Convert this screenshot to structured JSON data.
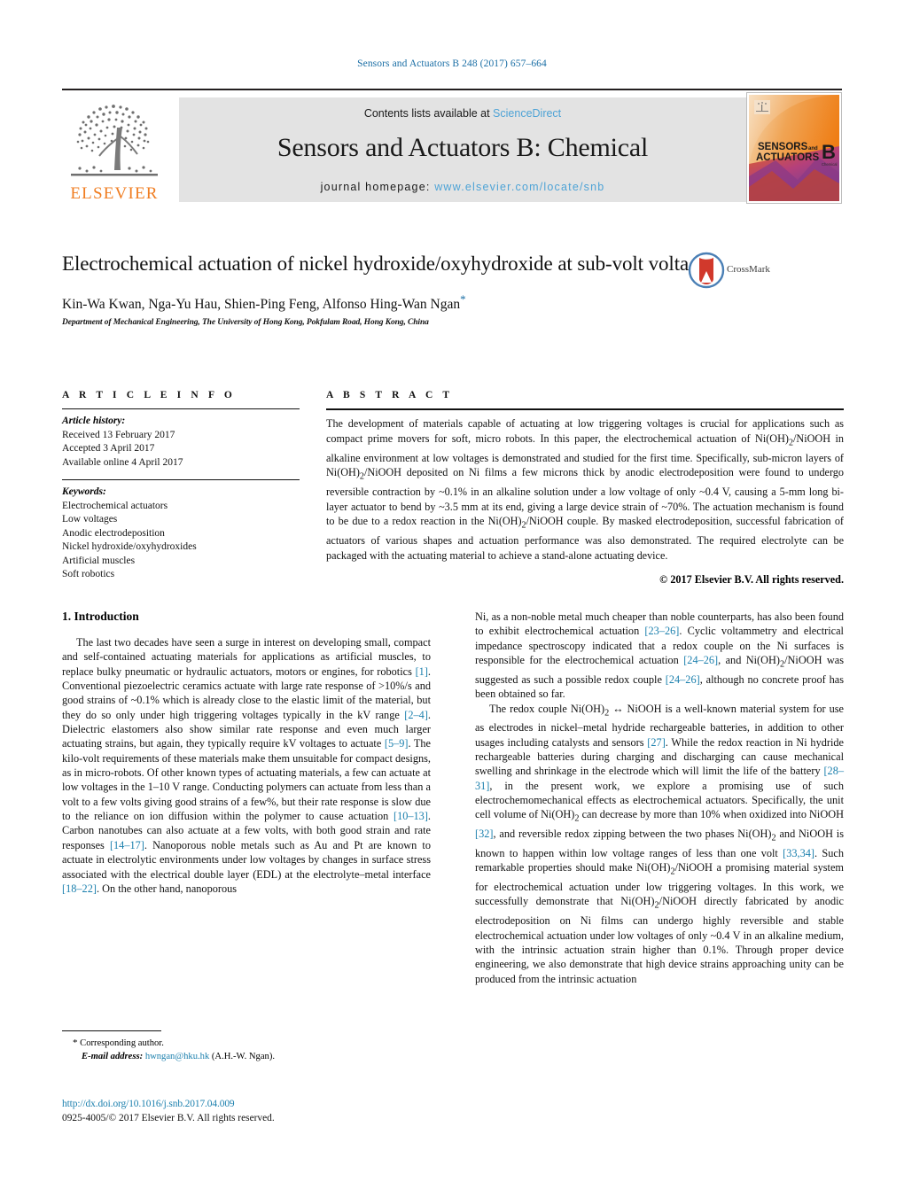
{
  "running_head": "Sensors and Actuators B 248 (2017) 657–664",
  "masthead": {
    "contents_prefix": "Contents lists available at ",
    "contents_link": "ScienceDirect",
    "journal_title": "Sensors and Actuators B: Chemical",
    "homepage_prefix": "journal homepage: ",
    "homepage_url": "www.elsevier.com/locate/snb",
    "publisher_name": "ELSEVIER",
    "cover": {
      "line1": "SENSORS",
      "line1b": "and",
      "line2": "ACTUATORS",
      "letter": "B",
      "sub": "Chemical"
    }
  },
  "article": {
    "title": "Electrochemical actuation of nickel hydroxide/oxyhydroxide at sub-volt voltages",
    "authors": "Kin-Wa Kwan, Nga-Yu Hau, Shien-Ping Feng, Alfonso Hing-Wan Ngan",
    "author_star": "*",
    "affiliation": "Department of Mechanical Engineering, The University of Hong Kong, Pokfulam Road, Hong Kong, China",
    "crossmark_label": "CrossMark"
  },
  "article_info": {
    "heading": "A R T I C L E   I N F O",
    "history_label": "Article history:",
    "history": [
      "Received 13 February 2017",
      "Accepted 3 April 2017",
      "Available online 4 April 2017"
    ],
    "keywords_label": "Keywords:",
    "keywords": [
      "Electrochemical actuators",
      "Low voltages",
      "Anodic electrodeposition",
      "Nickel hydroxide/oxyhydroxides",
      "Artificial muscles",
      "Soft robotics"
    ]
  },
  "abstract": {
    "heading": "A B S T R A C T",
    "text": "The development of materials capable of actuating at low triggering voltages is crucial for applications such as compact prime movers for soft, micro robots. In this paper, the electrochemical actuation of Ni(OH)2/NiOOH in alkaline environment at low voltages is demonstrated and studied for the first time. Specifically, sub-micron layers of Ni(OH)2/NiOOH deposited on Ni films a few microns thick by anodic electrodeposition were found to undergo reversible contraction by ~0.1% in an alkaline solution under a low voltage of only ~0.4 V, causing a 5-mm long bi-layer actuator to bend by ~3.5 mm at its end, giving a large device strain of ~70%. The actuation mechanism is found to be due to a redox reaction in the Ni(OH)2/NiOOH couple. By masked electrodeposition, successful fabrication of actuators of various shapes and actuation performance was also demonstrated. The required electrolyte can be packaged with the actuating material to achieve a stand-alone actuating device.",
    "copyright": "© 2017 Elsevier B.V. All rights reserved."
  },
  "body": {
    "section_number_title": "1. Introduction",
    "left_paragraph": "The last two decades have seen a surge in interest on developing small, compact and self-contained actuating materials for applications as artificial muscles, to replace bulky pneumatic or hydraulic actuators, motors or engines, for robotics [1]. Conventional piezoelectric ceramics actuate with large rate response of >10%/s and good strains of ~0.1% which is already close to the elastic limit of the material, but they do so only under high triggering voltages typically in the kV range [2–4]. Dielectric elastomers also show similar rate response and even much larger actuating strains, but again, they typically require kV voltages to actuate [5–9]. The kilo-volt requirements of these materials make them unsuitable for compact designs, as in micro-robots. Of other known types of actuating materials, a few can actuate at low voltages in the 1–10 V range. Conducting polymers can actuate from less than a volt to a few volts giving good strains of a few%, but their rate response is slow due to the reliance on ion diffusion within the polymer to cause actuation [10–13]. Carbon nanotubes can also actuate at a few volts, with both good strain and rate responses [14–17]. Nanoporous noble metals such as Au and Pt are known to actuate in electrolytic environments under low voltages by changes in surface stress associated with the electrical double layer (EDL) at the electrolyte–metal interface [18–22]. On the other hand, nanoporous",
    "right_paragraph_1": "Ni, as a non-noble metal much cheaper than noble counterparts, has also been found to exhibit electrochemical actuation [23–26]. Cyclic voltammetry and electrical impedance spectroscopy indicated that a redox couple on the Ni surfaces is responsible for the electrochemical actuation [24–26], and Ni(OH)2/NiOOH was suggested as such a possible redox couple [24–26], although no concrete proof has been obtained so far.",
    "right_paragraph_2": "The redox couple Ni(OH)2 ↔ NiOOH is a well-known material system for use as electrodes in nickel–metal hydride rechargeable batteries, in addition to other usages including catalysts and sensors [27]. While the redox reaction in Ni hydride rechargeable batteries during charging and discharging can cause mechanical swelling and shrinkage in the electrode which will limit the life of the battery [28–31], in the present work, we explore a promising use of such electrochemomechanical effects as electrochemical actuators. Specifically, the unit cell volume of Ni(OH)2 can decrease by more than 10% when oxidized into NiOOH [32], and reversible redox zipping between the two phases Ni(OH)2 and NiOOH is known to happen within low voltage ranges of less than one volt [33,34]. Such remarkable properties should make Ni(OH)2/NiOOH a promising material system for electrochemical actuation under low triggering voltages. In this work, we successfully demonstrate that Ni(OH)2/NiOOH directly fabricated by anodic electrodeposition on Ni films can undergo highly reversible and stable electrochemical actuation under low voltages of only ~0.4 V in an alkaline medium, with the intrinsic actuation strain higher than 0.1%. Through proper device engineering, we also demonstrate that high device strains approaching unity can be produced from the intrinsic actuation"
  },
  "footer": {
    "corresponding_star": "*",
    "corresponding_label": "Corresponding author.",
    "email_label": "E-mail address:",
    "email": "hwngan@hku.hk",
    "email_suffix": "(A.H.-W. Ngan).",
    "doi_url": "http://dx.doi.org/10.1016/j.snb.2017.04.009",
    "issn_line": "0925-4005/© 2017 Elsevier B.V. All rights reserved."
  },
  "colors": {
    "link_blue": "#1a7fad",
    "sciencedirect_blue": "#4ea3d6",
    "elsevier_orange": "#f07d21",
    "band_gray": "#e3e3e3"
  }
}
